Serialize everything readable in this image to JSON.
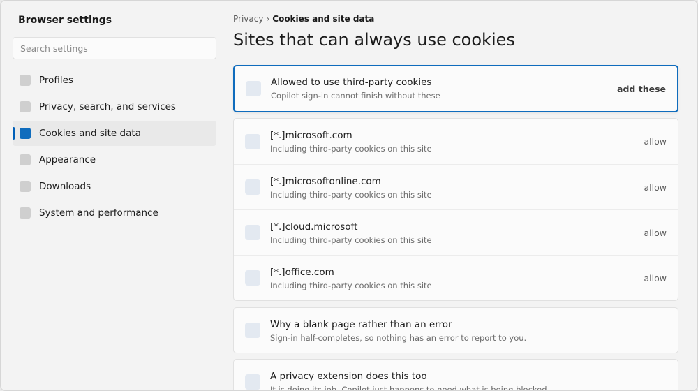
{
  "sidebar": {
    "title": "Browser settings",
    "search_placeholder": "Search settings",
    "items": [
      {
        "label": "Profiles"
      },
      {
        "label": "Privacy, search, and services"
      },
      {
        "label": "Cookies and site data"
      },
      {
        "label": "Appearance"
      },
      {
        "label": "Downloads"
      },
      {
        "label": "System and performance"
      }
    ],
    "active_item": "Cookies and site data"
  },
  "breadcrumb": {
    "parent": "Privacy",
    "separator": "›",
    "current": "Cookies and site data"
  },
  "page_title": "Sites that can always use cookies",
  "banner": {
    "title": "Allowed to use third-party cookies",
    "subtitle": "Copilot sign-in cannot finish without these",
    "action": "add these"
  },
  "sites": [
    {
      "domain": "[*.]microsoft.com",
      "detail": "Including third-party cookies on this site",
      "action": "allow"
    },
    {
      "domain": "[*.]microsoftonline.com",
      "detail": "Including third-party cookies on this site",
      "action": "allow"
    },
    {
      "domain": "[*.]cloud.microsoft",
      "detail": "Including third-party cookies on this site",
      "action": "allow"
    },
    {
      "domain": "[*.]office.com",
      "detail": "Including third-party cookies on this site",
      "action": "allow"
    }
  ],
  "info_cards": [
    {
      "title": "Why a blank page rather than an error",
      "subtitle": "Sign-in half-completes, so nothing has an error to report to you."
    },
    {
      "title": "A privacy extension does this too",
      "subtitle": "It is doing its job. Copilot just happens to need what is being blocked."
    }
  ],
  "colors": {
    "accent": "#0f6cbd",
    "background": "#f3f3f3",
    "card": "#fbfbfb"
  }
}
